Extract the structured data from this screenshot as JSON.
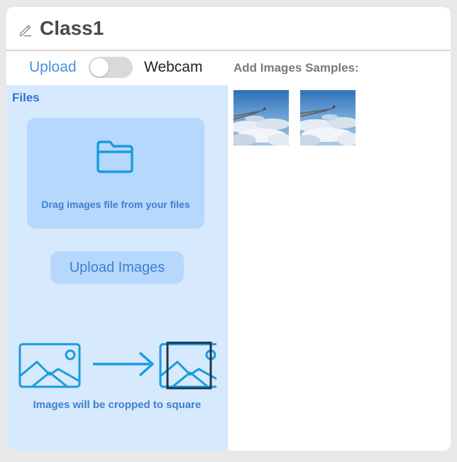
{
  "header": {
    "icon": "pencil-icon",
    "title": "Class1"
  },
  "source_toggle": {
    "left_label": "Upload",
    "right_label": "Webcam",
    "state": "upload"
  },
  "files_panel": {
    "heading": "Files",
    "drop_zone_icon": "folder-icon",
    "drop_zone_text": "Drag images file from your files",
    "upload_button_label": "Upload Images",
    "crop_note": "Images will be cropped to square",
    "crop_diagram_icons": [
      "image-icon",
      "arrow-right-icon",
      "image-crop-icon"
    ]
  },
  "samples": {
    "heading": "Add Images Samples:",
    "items": [
      {
        "kind": "image",
        "subject": "sky-clouds-airplane-wing"
      },
      {
        "kind": "image",
        "subject": "sky-clouds-airplane-wing"
      }
    ]
  },
  "colors": {
    "accent": "#4a90e2",
    "panel_bg": "#d6e9fd",
    "button_bg": "#b6d8fc",
    "icon_blue": "#1a9be0",
    "title_text": "#4a4a4a"
  }
}
